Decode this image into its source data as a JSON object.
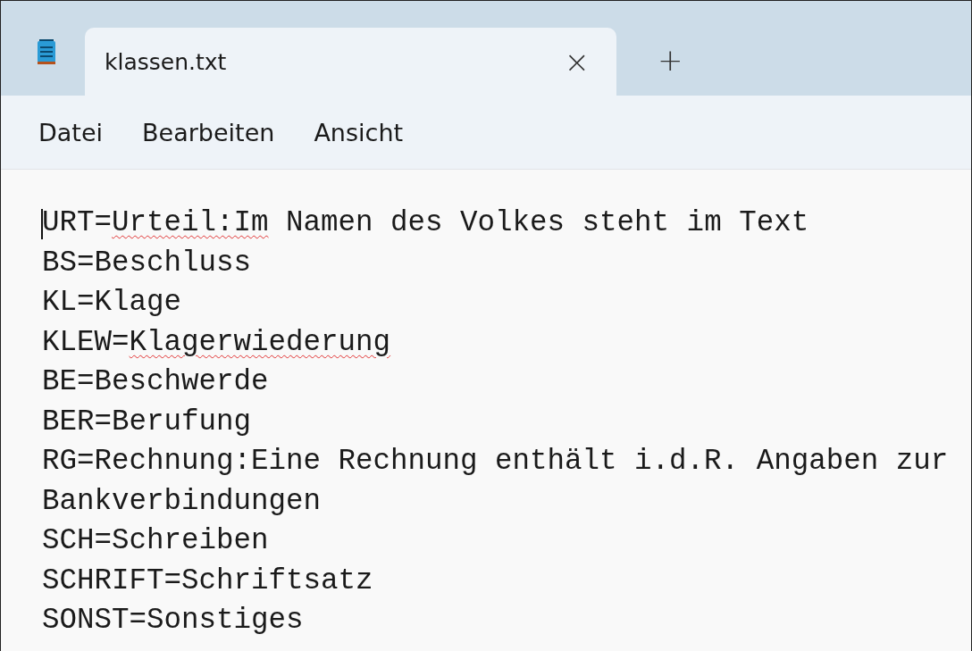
{
  "tabs": [
    {
      "title": "klassen.txt",
      "close": "×",
      "selected": true
    }
  ],
  "new_tab": "+",
  "menu": [
    {
      "label": "Datei"
    },
    {
      "label": "Bearbeiten"
    },
    {
      "label": "Ansicht"
    }
  ],
  "editor": {
    "caret": true,
    "lines": [
      [
        {
          "text": "URT="
        },
        {
          "text": "Urteil:Im",
          "misspelled": true
        },
        {
          "text": " Namen des Volkes steht im Text"
        }
      ],
      [
        {
          "text": "BS=Beschluss"
        }
      ],
      [
        {
          "text": "KL=Klage"
        }
      ],
      [
        {
          "text": "KLEW="
        },
        {
          "text": "Klagerwiederung",
          "misspelled": true
        }
      ],
      [
        {
          "text": "BE=Beschwerde"
        }
      ],
      [
        {
          "text": "BER=Berufung"
        }
      ],
      [
        {
          "text": "RG=Rechnung:Eine Rechnung enthält i.d.R. Angaben zur"
        }
      ],
      [
        {
          "text": "Bankverbindungen"
        }
      ],
      [
        {
          "text": "SCH=Schreiben"
        }
      ],
      [
        {
          "text": "SCHRIFT=Schriftsatz"
        }
      ],
      [
        {
          "text": "SONST=Sonstiges"
        }
      ]
    ]
  }
}
